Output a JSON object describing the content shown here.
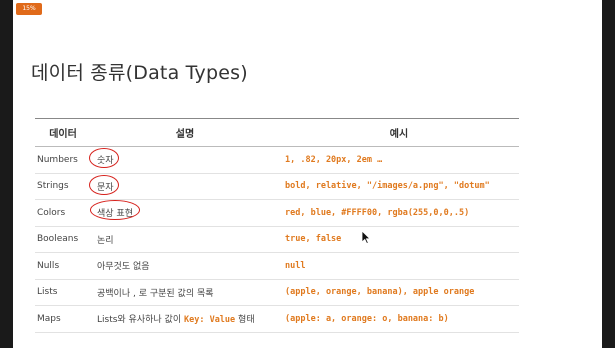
{
  "badge": "15%",
  "title": "데이터 종류(Data Types)",
  "table": {
    "headers": [
      "데이터",
      "설명",
      "예시"
    ],
    "rows": [
      {
        "type": "Numbers",
        "desc": "숫자",
        "example": "1, .82, 20px, 2em …"
      },
      {
        "type": "Strings",
        "desc": "문자",
        "example": "bold, relative, \"/images/a.png\", \"dotum\""
      },
      {
        "type": "Colors",
        "desc": "색상 표현",
        "example": "red, blue, #FFFF00, rgba(255,0,0,.5)"
      },
      {
        "type": "Booleans",
        "desc": "논리",
        "example": "true, false"
      },
      {
        "type": "Nulls",
        "desc": "아무것도 없음",
        "example": "null"
      },
      {
        "type": "Lists",
        "desc": "공백이나 , 로 구분된 값의 목록",
        "example": "(apple, orange, banana), apple orange"
      },
      {
        "type": "Maps",
        "desc_pre": "Lists와 유사하나 값이",
        "desc_code": "Key: Value",
        "desc_post": "형태",
        "example": "(apple: a, orange: o, banana: b)"
      }
    ]
  },
  "colors": {
    "code": "#e07a1f",
    "annotation": "#d6201b"
  }
}
